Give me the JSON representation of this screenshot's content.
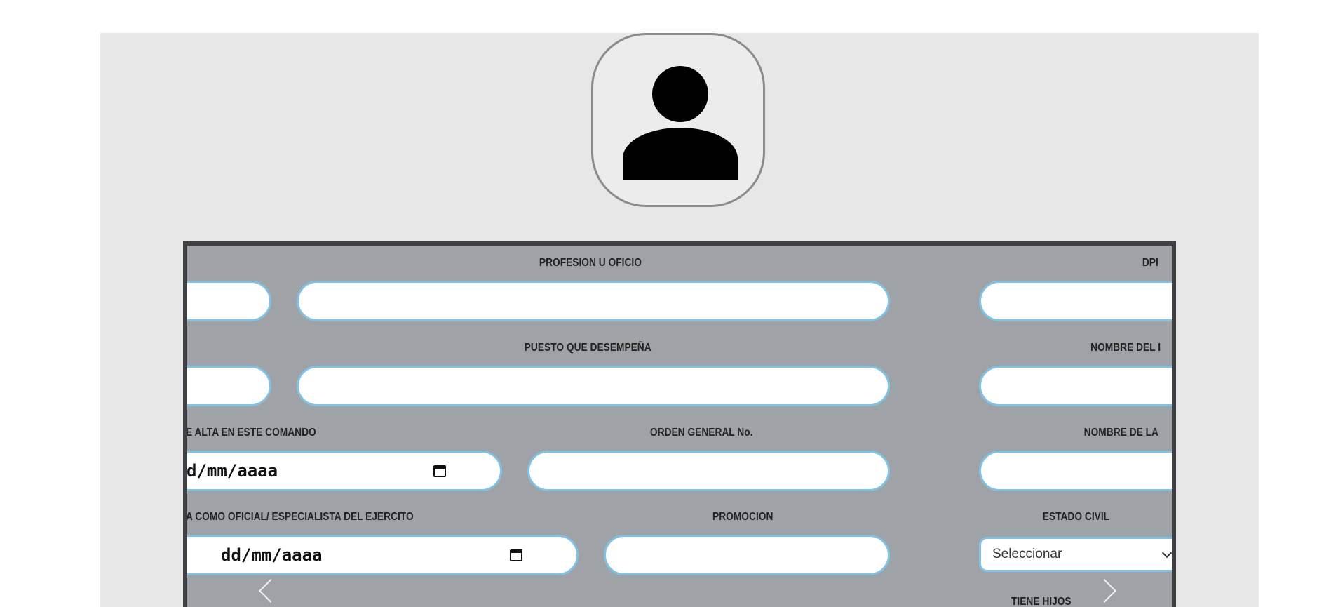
{
  "form": {
    "labels": {
      "profesion": "PROFESION U OFICIO",
      "dpi": "DPI",
      "puesto": "PUESTO QUE DESEMPEÑA",
      "nombre_del": "NOMBRE DEL I",
      "alta_comando": "E ALTA EN ESTE COMANDO",
      "orden_general": "ORDEN GENERAL No.",
      "nombre_de_la": "NOMBRE DE LA",
      "oficial_especialista": "A COMO OFICIAL/ ESPECIALISTA DEL EJERCITO",
      "promocion": "PROMOCION",
      "estado_civil": "ESTADO CIVIL",
      "tiene_hijos": "TIENE HIJOS"
    },
    "date_alta_value": "d/mm/aaaa",
    "date_oficial_value": "dd/mm/aaaa",
    "estado_civil_value": "Seleccionar"
  },
  "icons": {
    "avatar": "person-icon",
    "calendar": "calendar-icon",
    "prev": "chevron-left-icon",
    "next": "chevron-right-icon",
    "dropdown": "chevron-down-icon"
  },
  "colors": {
    "page_bg": "#e7e7e7",
    "card_bg": "#9fa2a6",
    "card_border": "#3e4044",
    "field_border": "#7fc2e6"
  }
}
